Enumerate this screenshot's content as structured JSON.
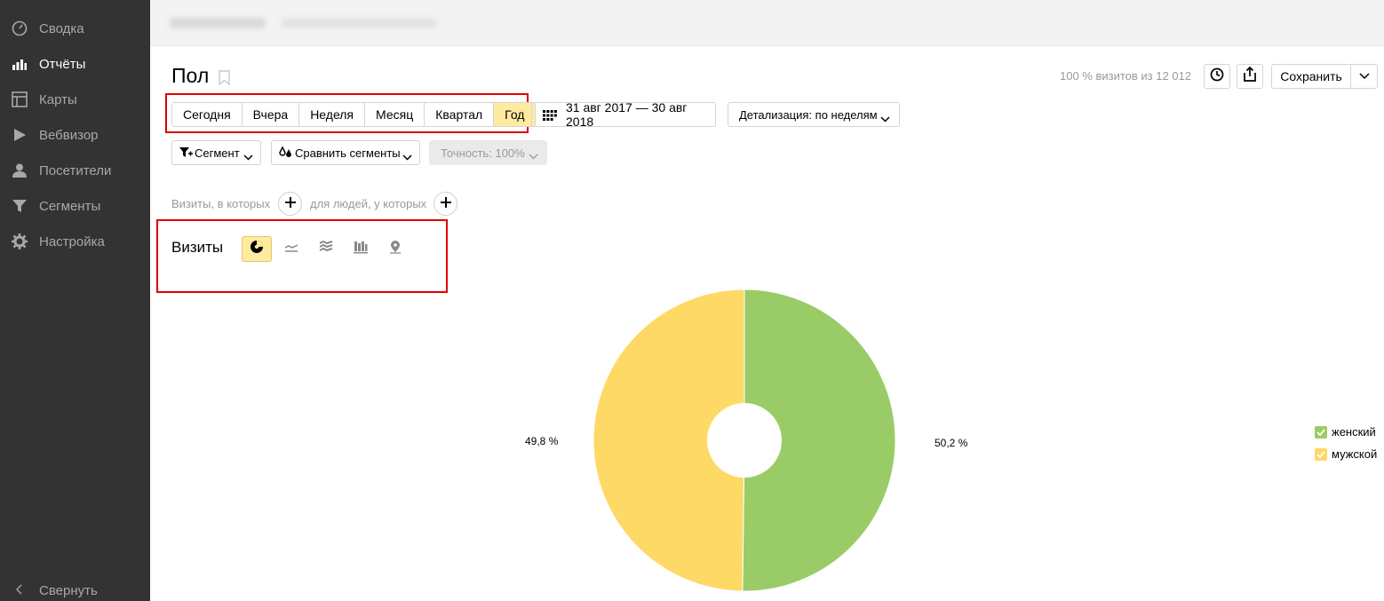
{
  "sidebar": {
    "items": [
      {
        "label": "Сводка",
        "icon": "dashboard-icon"
      },
      {
        "label": "Отчёты",
        "icon": "bar-chart-icon",
        "active": true
      },
      {
        "label": "Карты",
        "icon": "map-layout-icon"
      },
      {
        "label": "Вебвизор",
        "icon": "play-icon"
      },
      {
        "label": "Посетители",
        "icon": "person-icon"
      },
      {
        "label": "Сегменты",
        "icon": "funnel-icon"
      },
      {
        "label": "Настройка",
        "icon": "gear-icon"
      }
    ],
    "collapse_label": "Свернуть"
  },
  "header": {
    "title": "Пол",
    "visits_summary": "100 % визитов из 12 012",
    "save_label": "Сохранить"
  },
  "periods": {
    "items": [
      "Сегодня",
      "Вчера",
      "Неделя",
      "Месяц",
      "Квартал",
      "Год"
    ],
    "selected": "Год"
  },
  "date_range": "31 авг 2017 — 30 авг 2018",
  "detail": "Детализация: по неделям",
  "segment_label": "Сегмент",
  "compare_label": "Сравнить сегменты",
  "accuracy_label": "Точность: 100%",
  "filters": {
    "visits_prefix": "Визиты, в которых",
    "people_prefix": "для людей, у которых"
  },
  "chart_block": {
    "metric": "Визиты",
    "types": [
      "pie-chart-icon",
      "line-chart-icon",
      "area-chart-icon",
      "bar-chart-icon",
      "map-pin-icon"
    ],
    "selected_type": "pie-chart-icon"
  },
  "chart_data": {
    "type": "pie",
    "slices": [
      {
        "name": "женский",
        "value": 50.2,
        "label": "50,2 %",
        "color": "#99cc66"
      },
      {
        "name": "мужской",
        "value": 49.8,
        "label": "49,8 %",
        "color": "#ffd966"
      }
    ],
    "legend_position": "right"
  },
  "colors": {
    "sidebar_bg": "#333333",
    "selected_bg": "#ffeba0",
    "highlight_frame": "#e00000"
  }
}
